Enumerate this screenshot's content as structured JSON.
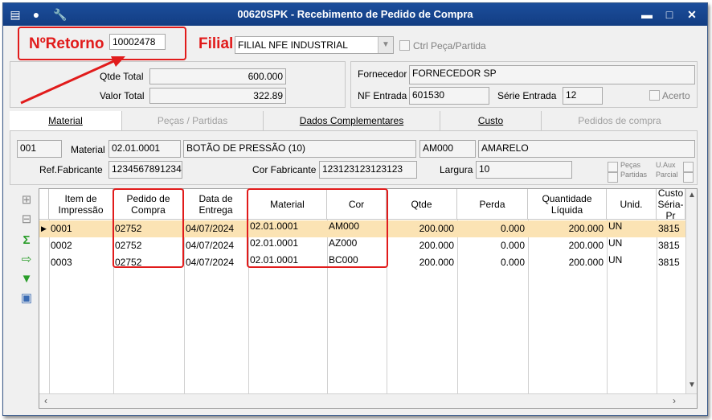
{
  "window": {
    "title": "00620SPK - Recebimento de Pedido de Compra",
    "minimize": "▬",
    "maximize": "□",
    "close": "✕",
    "titlebar_color": "#1b4b97"
  },
  "header": {
    "retorno_label": "NºRetorno",
    "retorno_value": "10002478",
    "filial_label": "Filial",
    "filial_value": "FILIAL NFE INDUSTRIAL",
    "ctrl_label": "Ctrl Peça/Partida",
    "qtde_total_label": "Qtde Total",
    "qtde_total_value": "600.000",
    "valor_total_label": "Valor Total",
    "valor_total_value": "322.89",
    "fornecedor_label": "Fornecedor",
    "fornecedor_value": "FORNECEDOR SP",
    "nf_entrada_label": "NF Entrada",
    "nf_entrada_value": "601530",
    "serie_label": "Série Entrada",
    "serie_value": "12",
    "acerto_label": "Acerto",
    "accent_red": "#e11b1b"
  },
  "tabs": [
    {
      "label": "Material"
    },
    {
      "label": "Peças / Partidas"
    },
    {
      "label": "Dados Complementares"
    },
    {
      "label": "Custo"
    },
    {
      "label": "Pedidos de compra"
    }
  ],
  "material": {
    "seq": "001",
    "material_label": "Material",
    "material_code": "02.01.0001",
    "material_desc": "BOTÃO DE PRESSÃO (10)",
    "color_code": "AM000",
    "color_desc": "AMARELO",
    "ref_fab_label": "Ref.Fabricante",
    "ref_fab_value": "1234567891234",
    "cor_fab_label": "Cor Fabricante",
    "cor_fab_value": "123123123123123",
    "largura_label": "Largura",
    "largura_value": "10",
    "pecas_label": "Peças",
    "partidas_label": "Partidas",
    "uaux_label": "U.Aux",
    "parcial_label": "Parcial"
  },
  "grid": {
    "headers": {
      "item": "Item de Impressão",
      "pedido": "Pedido de Compra",
      "data": "Data de Entrega",
      "material": "Material",
      "cor": "Cor",
      "qtde": "Qtde",
      "perda": "Perda",
      "qtd_liq": "Quantidade Líquida",
      "unid": "Unid.",
      "custo": "Custo Séria-Pr"
    },
    "rows": [
      {
        "item": "0001",
        "pedido": "02752",
        "data": "04/07/2024",
        "material": "02.01.0001",
        "cor": "AM000",
        "qtde": "200.000",
        "perda": "0.000",
        "qtd_liq": "200.000",
        "unid": "UN",
        "custo": "3815"
      },
      {
        "item": "0002",
        "pedido": "02752",
        "data": "04/07/2024",
        "material": "02.01.0001",
        "cor": "AZ000",
        "qtde": "200.000",
        "perda": "0.000",
        "qtd_liq": "200.000",
        "unid": "UN",
        "custo": "3815"
      },
      {
        "item": "0003",
        "pedido": "02752",
        "data": "04/07/2024",
        "material": "02.01.0001",
        "cor": "BC000",
        "qtde": "200.000",
        "perda": "0.000",
        "qtd_liq": "200.000",
        "unid": "UN",
        "custo": "3815"
      }
    ],
    "selected_row_color": "#fbe3b4"
  }
}
